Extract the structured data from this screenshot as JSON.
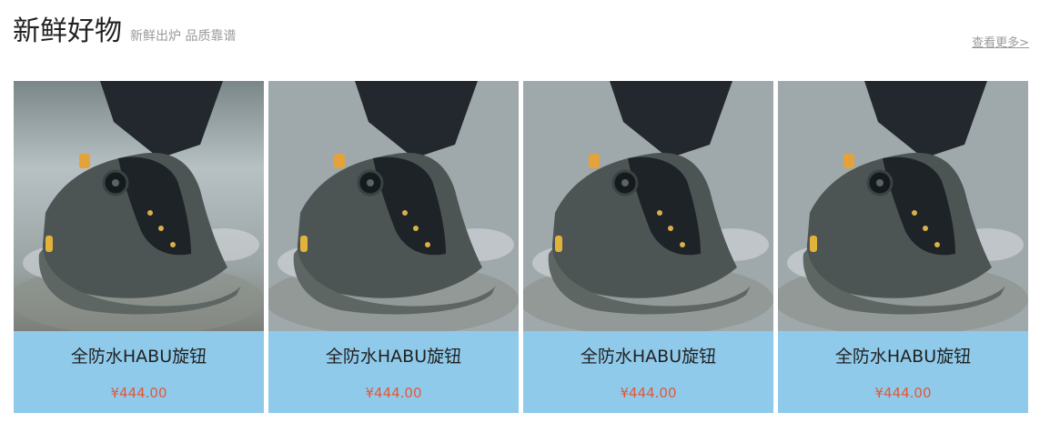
{
  "section": {
    "title": "新鲜好物",
    "subtitle": "新鲜出炉 品质靠谱",
    "more_label": "查看更多>"
  },
  "products": [
    {
      "name": "全防水HABU旋钮",
      "price": "¥444.00",
      "image": "hiking-shoe-photo"
    },
    {
      "name": "全防水HABU旋钮",
      "price": "¥444.00",
      "image": "hiking-shoe-photo"
    },
    {
      "name": "全防水HABU旋钮",
      "price": "¥444.00",
      "image": "hiking-shoe-photo"
    },
    {
      "name": "全防水HABU旋钮",
      "price": "¥444.00",
      "image": "hiking-shoe-photo"
    }
  ],
  "colors": {
    "card_info_bg": "#8fcaea",
    "price": "#e3583a",
    "subtitle": "#999999"
  }
}
